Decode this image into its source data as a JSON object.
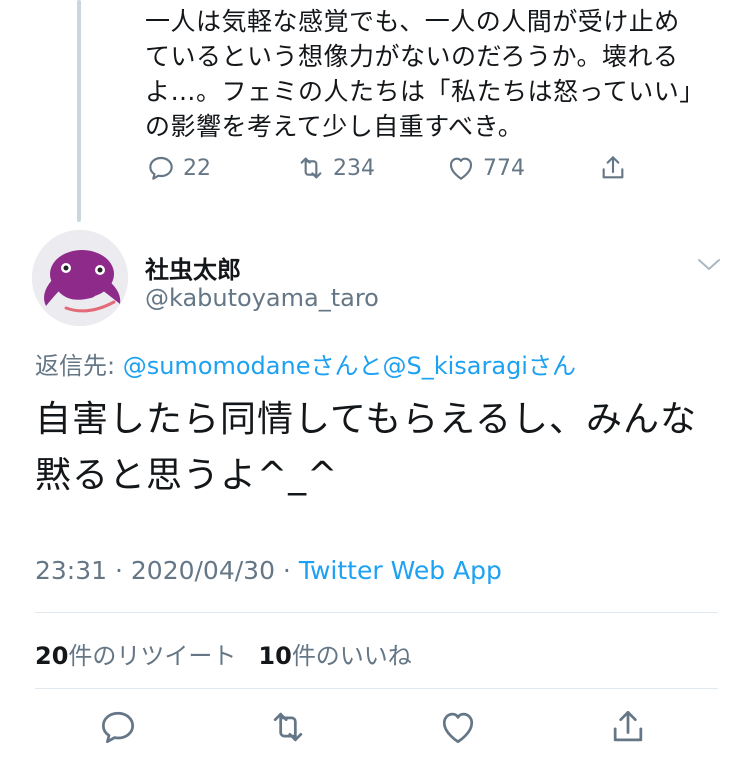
{
  "parent_tweet": {
    "text": "一人は気軽な感覚でも、一人の人間が受け止め\nているという想像力がないのだろうか。壊れる\nよ…。フェミの人たちは「私たちは怒っていい」\nの影響を考えて少し自重すべき。",
    "replies": "22",
    "retweets": "234",
    "likes": "774"
  },
  "tweet": {
    "display_name": "社虫太郎",
    "handle": "@kabutoyama_taro",
    "reply_prefix": "返信先: ",
    "reply_user1": "@sumomodane",
    "reply_join": "さんと",
    "reply_user2": "@S_kisaragi",
    "reply_suffix": "さん",
    "text": "自害したら同情してもらえるし、みんな黙ると思うよ^_^",
    "time": "23:31 · 2020/04/30 · ",
    "source": "Twitter Web App",
    "retweet_count": "20",
    "retweet_label": "件のリツイート",
    "like_count": "10",
    "like_label": "件のいいね"
  },
  "colors": {
    "accent": "#1da1f2",
    "muted": "#657786",
    "text": "#14171a",
    "avatar_purple": "#8e2a8a"
  },
  "icons": [
    "reply-icon",
    "retweet-icon",
    "like-icon",
    "share-icon",
    "chevron-down-icon"
  ]
}
